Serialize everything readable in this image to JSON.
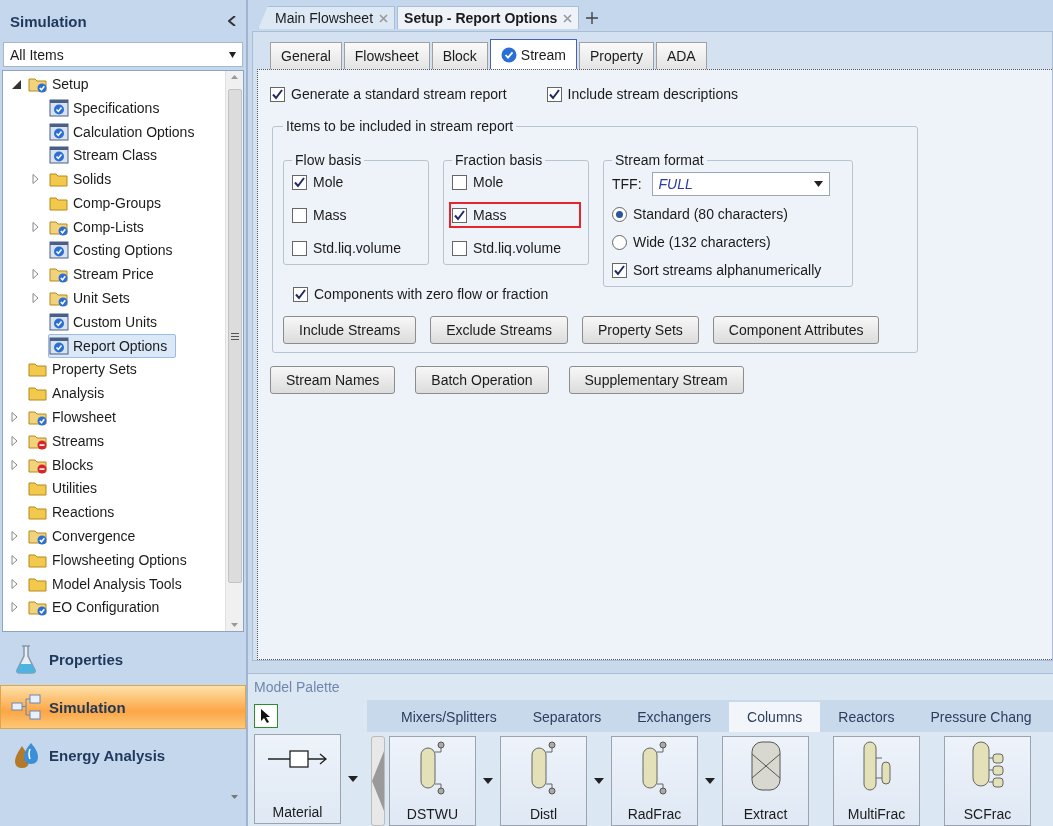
{
  "sidebar": {
    "title": "Simulation",
    "filter": {
      "value": "All Items"
    },
    "tree": [
      {
        "label": "Setup",
        "kind": "folder-check",
        "expanded": true,
        "selected": false,
        "children": [
          {
            "label": "Specifications",
            "kind": "form-check",
            "selected": false
          },
          {
            "label": "Calculation Options",
            "kind": "form-check",
            "selected": false
          },
          {
            "label": "Stream Class",
            "kind": "form-check",
            "selected": false
          },
          {
            "label": "Solids",
            "kind": "folder",
            "expanded": false,
            "selected": false
          },
          {
            "label": "Comp-Groups",
            "kind": "folder",
            "selected": false
          },
          {
            "label": "Comp-Lists",
            "kind": "folder-check",
            "expanded": false,
            "selected": false
          },
          {
            "label": "Costing Options",
            "kind": "form-check",
            "selected": false
          },
          {
            "label": "Stream Price",
            "kind": "folder-check",
            "expanded": false,
            "selected": false
          },
          {
            "label": "Unit Sets",
            "kind": "folder-check",
            "expanded": false,
            "selected": false
          },
          {
            "label": "Custom Units",
            "kind": "form-check",
            "selected": false
          },
          {
            "label": "Report Options",
            "kind": "form-check",
            "selected": true
          }
        ]
      },
      {
        "label": "Property Sets",
        "kind": "folder",
        "selected": false
      },
      {
        "label": "Analysis",
        "kind": "folder",
        "selected": false
      },
      {
        "label": "Flowsheet",
        "kind": "folder-check",
        "expanded": false,
        "selected": false
      },
      {
        "label": "Streams",
        "kind": "folder-error",
        "expanded": false,
        "selected": false
      },
      {
        "label": "Blocks",
        "kind": "folder-error",
        "expanded": false,
        "selected": false
      },
      {
        "label": "Utilities",
        "kind": "folder",
        "selected": false
      },
      {
        "label": "Reactions",
        "kind": "folder",
        "selected": false
      },
      {
        "label": "Convergence",
        "kind": "folder-check",
        "expanded": false,
        "selected": false
      },
      {
        "label": "Flowsheeting Options",
        "kind": "folder",
        "expanded": false,
        "selected": false
      },
      {
        "label": "Model Analysis Tools",
        "kind": "folder",
        "expanded": false,
        "selected": false
      },
      {
        "label": "EO Configuration",
        "kind": "folder-check",
        "expanded": false,
        "selected": false
      }
    ],
    "nav": [
      {
        "label": "Properties",
        "kind": "flask",
        "selected": false
      },
      {
        "label": "Simulation",
        "kind": "flowsheet",
        "selected": true
      },
      {
        "label": "Energy Analysis",
        "kind": "drop",
        "selected": false
      }
    ]
  },
  "document_tabs": [
    {
      "label": "Main Flowsheet",
      "selected": false
    },
    {
      "label": "Setup - Report Options",
      "selected": true
    }
  ],
  "form_tabs": [
    {
      "label": "General",
      "selected": false,
      "complete": false
    },
    {
      "label": "Flowsheet",
      "selected": false,
      "complete": false
    },
    {
      "label": "Block",
      "selected": false,
      "complete": false
    },
    {
      "label": "Stream",
      "selected": true,
      "complete": true
    },
    {
      "label": "Property",
      "selected": false,
      "complete": false
    },
    {
      "label": "ADA",
      "selected": false,
      "complete": false
    }
  ],
  "options": [
    {
      "label": "Generate a standard stream report",
      "checked": true
    },
    {
      "label": "Include stream descriptions",
      "checked": true
    }
  ],
  "report_items": {
    "title": "Items to be included in stream report",
    "flow_basis": {
      "title": "Flow basis",
      "options": [
        {
          "label": "Mole",
          "checked": true
        },
        {
          "label": "Mass",
          "checked": false
        },
        {
          "label": "Std.liq.volume",
          "checked": false
        }
      ]
    },
    "fraction_basis": {
      "title": "Fraction basis",
      "options": [
        {
          "label": "Mole",
          "checked": false
        },
        {
          "label": "Mass",
          "checked": true,
          "highlighted": true
        },
        {
          "label": "Std.liq.volume",
          "checked": false
        }
      ]
    },
    "stream_format": {
      "title": "Stream format",
      "tff_label": "TFF:",
      "tff_value": "FULL",
      "layouts": [
        {
          "label": "Standard (80 characters)",
          "selected": true
        },
        {
          "label": "Wide (132 characters)",
          "selected": false
        }
      ],
      "sort": {
        "label": "Sort streams alphanumerically",
        "checked": true
      }
    },
    "zero_flow": {
      "label": "Components with zero flow or fraction",
      "checked": true
    },
    "buttons": [
      "Include Streams",
      "Exclude Streams",
      "Property Sets",
      "Component Attributes"
    ]
  },
  "buttons": [
    "Stream Names",
    "Batch Operation",
    "Supplementary Stream"
  ],
  "palette": {
    "title": "Model Palette",
    "categories": [
      {
        "label": "Mixers/Splitters",
        "selected": false
      },
      {
        "label": "Separators",
        "selected": false
      },
      {
        "label": "Exchangers",
        "selected": false
      },
      {
        "label": "Columns",
        "selected": true
      },
      {
        "label": "Reactors",
        "selected": false
      },
      {
        "label": "Pressure Chang",
        "selected": false
      }
    ],
    "stream": {
      "label": "Material"
    },
    "models": [
      {
        "label": "DSTWU",
        "kind": "column",
        "menu": true
      },
      {
        "label": "Distl",
        "kind": "column",
        "menu": true
      },
      {
        "label": "RadFrac",
        "kind": "column",
        "menu": true
      },
      {
        "label": "Extract",
        "kind": "extractor"
      },
      {
        "label": "MultiFrac",
        "kind": "multicolumn"
      },
      {
        "label": "SCFrac",
        "kind": "scfrac"
      }
    ]
  }
}
